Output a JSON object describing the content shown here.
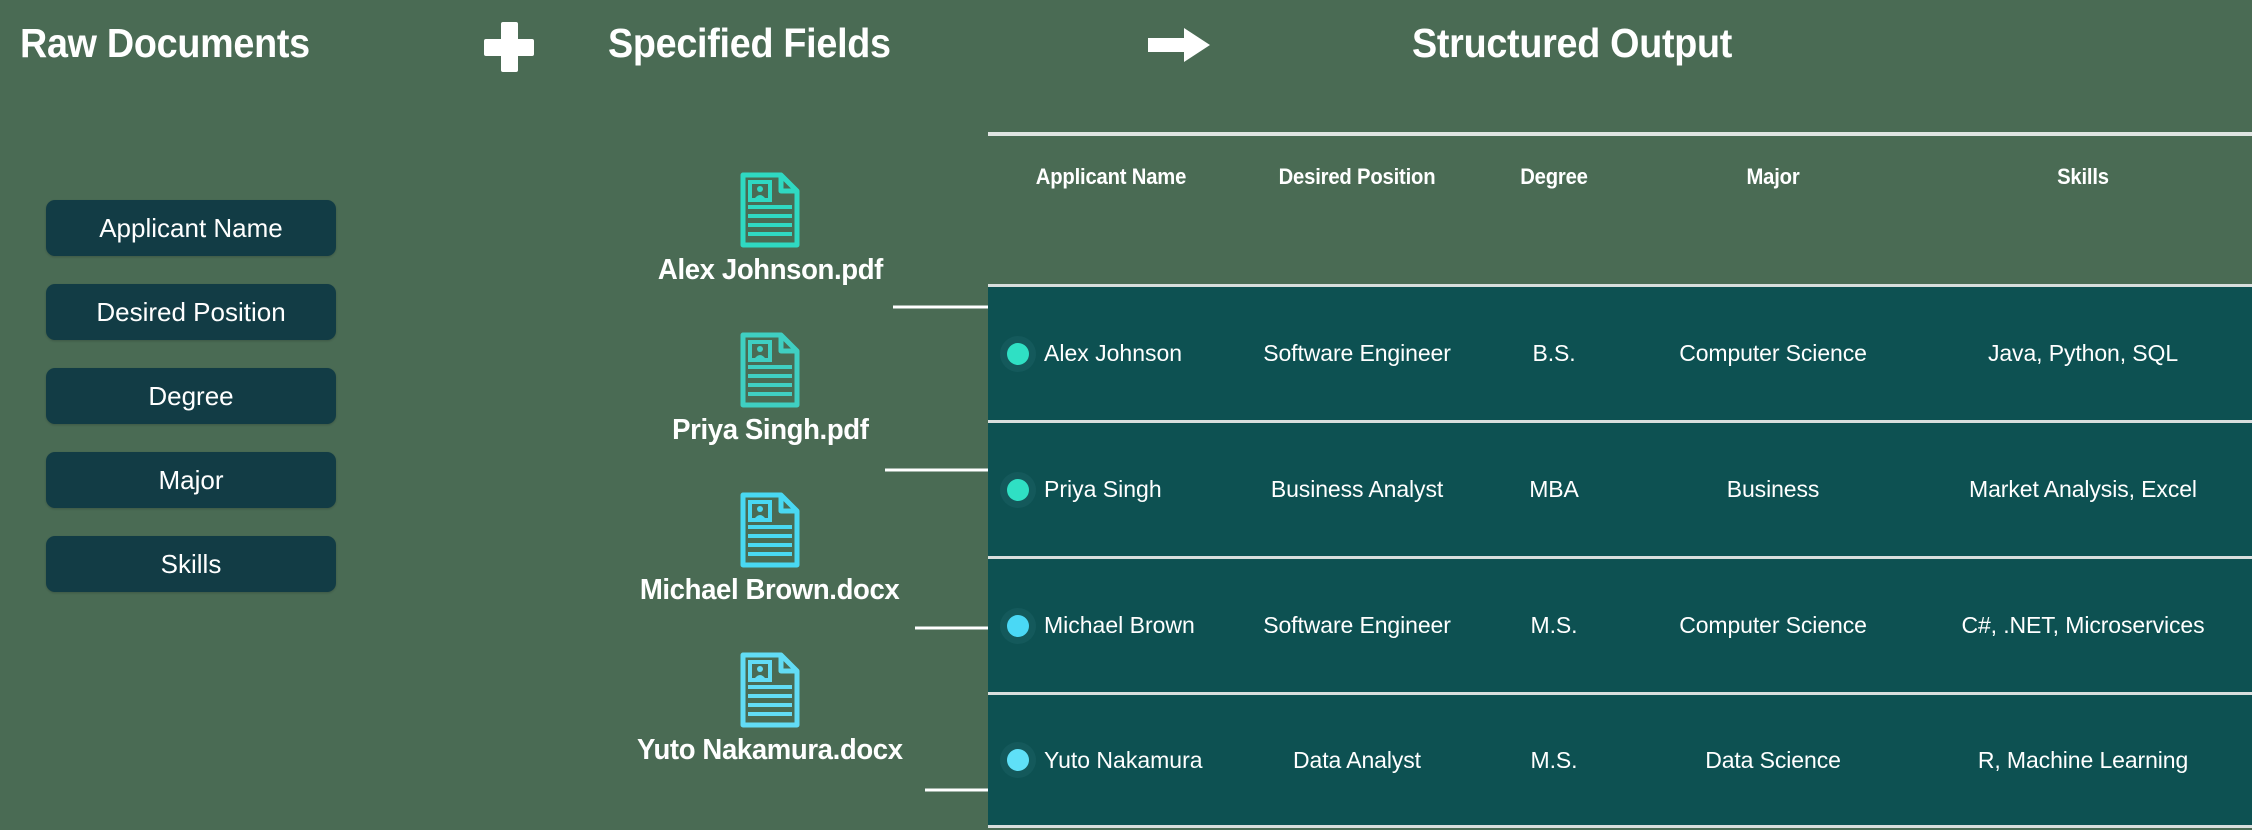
{
  "headings": {
    "raw_documents": "Raw Documents",
    "specified_fields": "Specified Fields",
    "structured_output": "Structured Output",
    "plus_icon": "plus-icon",
    "arrow_icon": "arrow-right-icon"
  },
  "colors": {
    "background": "#4a6b54",
    "chip_background": "#123c45",
    "table_row_background": "#0d5152",
    "rule": "#dfe4e2",
    "accent_teal": "#2fd9c2",
    "accent_cyan": "#3fd2f0",
    "text": "#ffffff"
  },
  "fields": [
    {
      "label": "Applicant Name"
    },
    {
      "label": "Desired Position"
    },
    {
      "label": "Degree"
    },
    {
      "label": "Major"
    },
    {
      "label": "Skills"
    }
  ],
  "documents": [
    {
      "filename": "Alex Johnson.pdf",
      "icon": "resume-document-icon",
      "icon_color": "#2fd9c2"
    },
    {
      "filename": "Priya Singh.pdf",
      "icon": "resume-document-icon",
      "icon_color": "#3fcfc2"
    },
    {
      "filename": "Michael Brown.docx",
      "icon": "resume-document-icon",
      "icon_color": "#49d8f2"
    },
    {
      "filename": "Yuto Nakamura.docx",
      "icon": "resume-document-icon",
      "icon_color": "#62dcf5"
    }
  ],
  "table": {
    "columns": [
      "Applicant Name",
      "Desired Position",
      "Degree",
      "Major",
      "Skills"
    ],
    "rows": [
      {
        "dot_color": "#2fe0c4",
        "applicant_name": "Alex Johnson",
        "desired_position": "Software Engineer",
        "degree": "B.S.",
        "major": "Computer Science",
        "skills": "Java, Python, SQL"
      },
      {
        "dot_color": "#2fe0c4",
        "applicant_name": "Priya Singh",
        "desired_position": "Business Analyst",
        "degree": "MBA",
        "major": "Business",
        "skills": "Market Analysis, Excel"
      },
      {
        "dot_color": "#4ad8f5",
        "applicant_name": "Michael Brown",
        "desired_position": "Software Engineer",
        "degree": "M.S.",
        "major": "Computer Science",
        "skills": "C#, .NET, Microservices"
      },
      {
        "dot_color": "#5fe0f7",
        "applicant_name": "Yuto Nakamura",
        "desired_position": "Data Analyst",
        "degree": "M.S.",
        "major": "Data Science",
        "skills": "R, Machine Learning"
      }
    ]
  }
}
